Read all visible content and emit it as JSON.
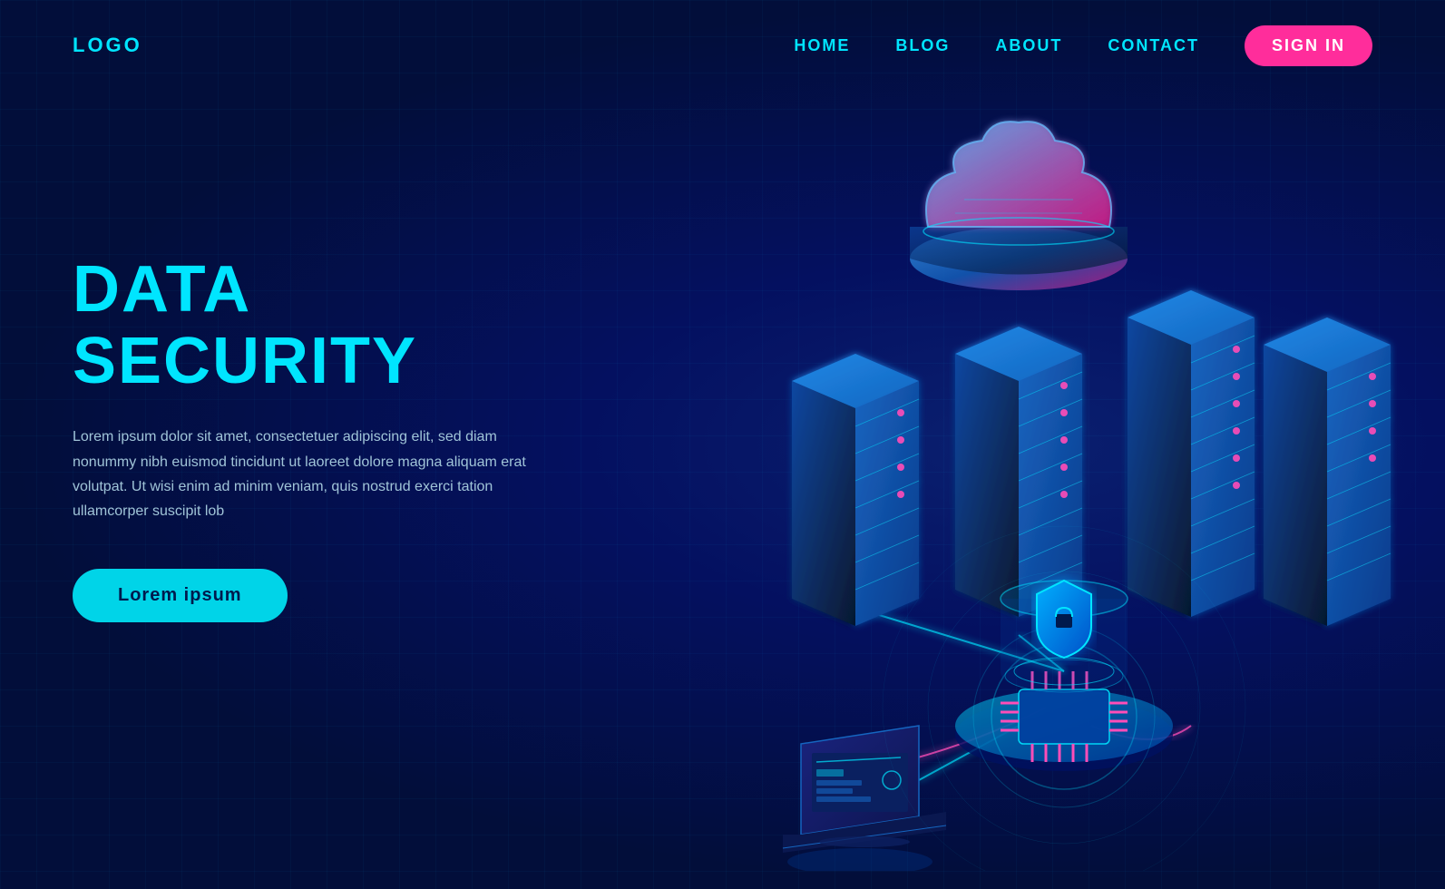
{
  "nav": {
    "logo": "LOGO",
    "links": [
      {
        "label": "HOME",
        "id": "home"
      },
      {
        "label": "BLOG",
        "id": "blog"
      },
      {
        "label": "ABOUT",
        "id": "about"
      },
      {
        "label": "CONTACT",
        "id": "contact"
      }
    ],
    "signin": "SIGN IN"
  },
  "hero": {
    "title": "DATA SECURITY",
    "description": "Lorem ipsum dolor sit amet, consectetuer adipiscing elit, sed diam nonummy nibh euismod tincidunt ut laoreet dolore magna aliquam erat volutpat. Ut wisi enim ad minim veniam, quis nostrud exerci tation ullamcorper suscipit lob",
    "cta_label": "Lorem ipsum"
  },
  "colors": {
    "bg_dark": "#020e3a",
    "bg_mid": "#041060",
    "cyan": "#00e5ff",
    "pink": "#ff2d9b",
    "server_face": "#0a3080",
    "server_side": "#061850",
    "server_top": "#1050c0",
    "cloud_body": "#1840a0",
    "shield_blue": "#0060d0",
    "accent_pink": "#ff4db8",
    "btn_bg": "#00d4e8"
  }
}
